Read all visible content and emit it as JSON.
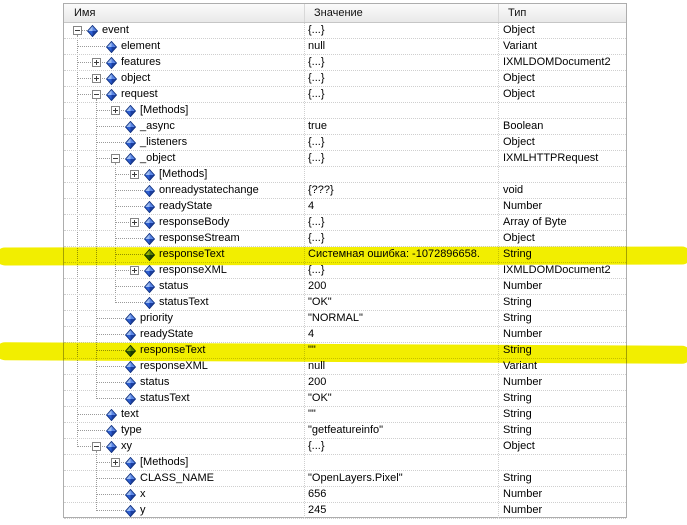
{
  "table": {
    "columns": [
      {
        "label": "Имя"
      },
      {
        "label": "Значение"
      },
      {
        "label": "Тип"
      }
    ],
    "rows": [
      {
        "name": "event",
        "value": "{...}",
        "type": "Object",
        "level": 0,
        "expander": "expanded",
        "highlighted": false
      },
      {
        "name": "element",
        "value": "null",
        "type": "Variant",
        "level": 1,
        "expander": "none",
        "highlighted": false
      },
      {
        "name": "features",
        "value": "{...}",
        "type": "IXMLDOMDocument2",
        "level": 1,
        "expander": "collapsed",
        "highlighted": false
      },
      {
        "name": "object",
        "value": "{...}",
        "type": "Object",
        "level": 1,
        "expander": "collapsed",
        "highlighted": false
      },
      {
        "name": "request",
        "value": "{...}",
        "type": "Object",
        "level": 1,
        "expander": "expanded",
        "highlighted": false
      },
      {
        "name": "[Methods]",
        "value": "",
        "type": "",
        "level": 2,
        "expander": "collapsed",
        "highlighted": false
      },
      {
        "name": "_async",
        "value": "true",
        "type": "Boolean",
        "level": 2,
        "expander": "none",
        "highlighted": false
      },
      {
        "name": "_listeners",
        "value": "{...}",
        "type": "Object",
        "level": 2,
        "expander": "none",
        "highlighted": false
      },
      {
        "name": "_object",
        "value": "{...}",
        "type": "IXMLHTTPRequest",
        "level": 2,
        "expander": "expanded",
        "highlighted": false
      },
      {
        "name": "[Methods]",
        "value": "",
        "type": "",
        "level": 3,
        "expander": "collapsed",
        "highlighted": false
      },
      {
        "name": "onreadystatechange",
        "value": "{???}",
        "type": "void",
        "level": 3,
        "expander": "none",
        "highlighted": false
      },
      {
        "name": "readyState",
        "value": "4",
        "type": "Number",
        "level": 3,
        "expander": "none",
        "highlighted": false
      },
      {
        "name": "responseBody",
        "value": "{...}",
        "type": "Array of Byte",
        "level": 3,
        "expander": "collapsed",
        "highlighted": false
      },
      {
        "name": "responseStream",
        "value": "{...}",
        "type": "Object",
        "level": 3,
        "expander": "none",
        "highlighted": false
      },
      {
        "name": "responseText",
        "value": "Системная ошибка: -1072896658.",
        "type": "String",
        "level": 3,
        "expander": "none",
        "highlighted": true
      },
      {
        "name": "responseXML",
        "value": "{...}",
        "type": "IXMLDOMDocument2",
        "level": 3,
        "expander": "collapsed",
        "highlighted": false
      },
      {
        "name": "status",
        "value": "200",
        "type": "Number",
        "level": 3,
        "expander": "none",
        "highlighted": false
      },
      {
        "name": "statusText",
        "value": "\"OK\"",
        "type": "String",
        "level": 3,
        "expander": "none",
        "highlighted": false
      },
      {
        "name": "priority",
        "value": "\"NORMAL\"",
        "type": "String",
        "level": 2,
        "expander": "none",
        "highlighted": false
      },
      {
        "name": "readyState",
        "value": "4",
        "type": "Number",
        "level": 2,
        "expander": "none",
        "highlighted": false
      },
      {
        "name": "responseText",
        "value": "\"\"",
        "type": "String",
        "level": 2,
        "expander": "none",
        "highlighted": true
      },
      {
        "name": "responseXML",
        "value": "null",
        "type": "Variant",
        "level": 2,
        "expander": "none",
        "highlighted": false
      },
      {
        "name": "status",
        "value": "200",
        "type": "Number",
        "level": 2,
        "expander": "none",
        "highlighted": false
      },
      {
        "name": "statusText",
        "value": "\"OK\"",
        "type": "String",
        "level": 2,
        "expander": "none",
        "highlighted": false
      },
      {
        "name": "text",
        "value": "\"\"",
        "type": "String",
        "level": 1,
        "expander": "none",
        "highlighted": false
      },
      {
        "name": "type",
        "value": "\"getfeatureinfo\"",
        "type": "String",
        "level": 1,
        "expander": "none",
        "highlighted": false
      },
      {
        "name": "xy",
        "value": "{...}",
        "type": "Object",
        "level": 1,
        "expander": "expanded",
        "highlighted": false
      },
      {
        "name": "[Methods]",
        "value": "",
        "type": "",
        "level": 2,
        "expander": "collapsed",
        "highlighted": false
      },
      {
        "name": "CLASS_NAME",
        "value": "\"OpenLayers.Pixel\"",
        "type": "String",
        "level": 2,
        "expander": "none",
        "highlighted": false
      },
      {
        "name": "x",
        "value": "656",
        "type": "Number",
        "level": 2,
        "expander": "none",
        "highlighted": false
      },
      {
        "name": "y",
        "value": "245",
        "type": "Number",
        "level": 2,
        "expander": "none",
        "highlighted": false
      }
    ]
  },
  "colors": {
    "highlight_marker": "#f2ee00",
    "icon_light": "#9dbcf2",
    "icon_mid": "#5b86e5",
    "icon_mid2": "#2d5fd3",
    "icon_dark": "#1b3fa0",
    "icon_outline": "#12327e"
  }
}
